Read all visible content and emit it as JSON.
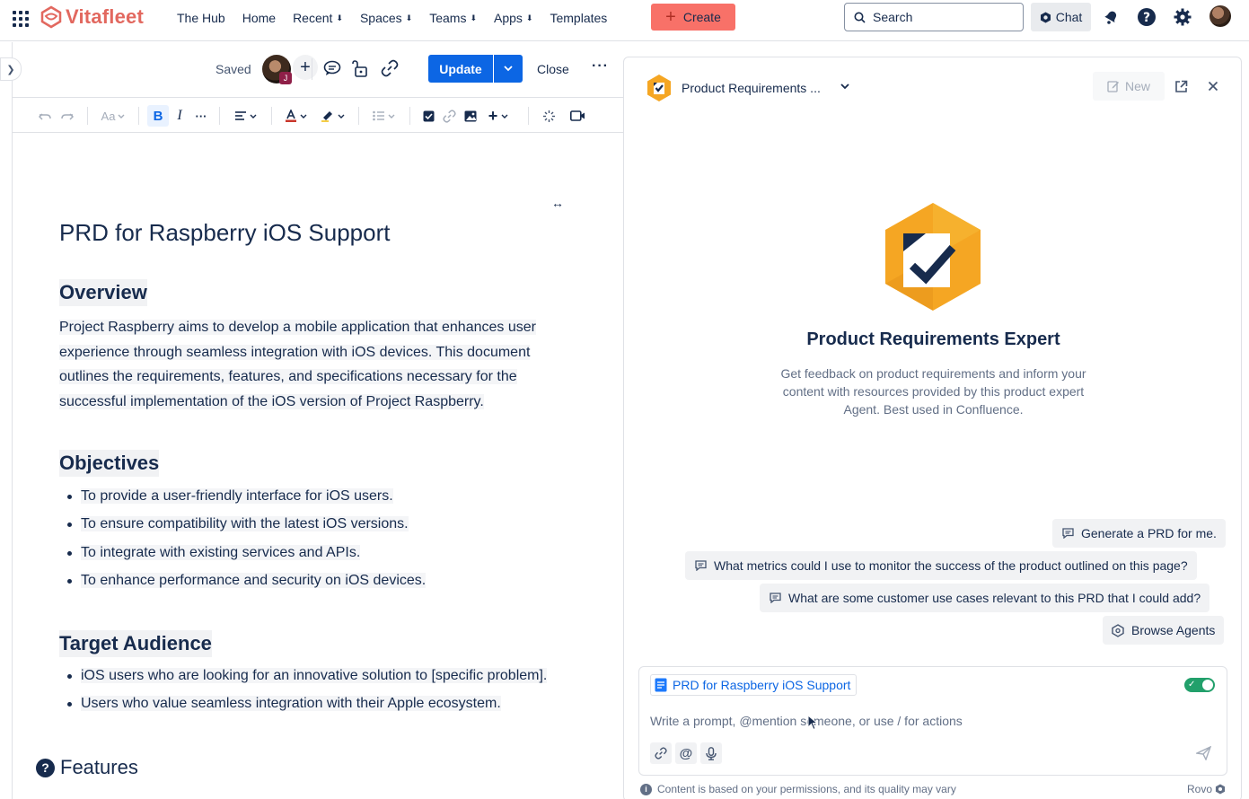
{
  "topnav": {
    "brand": "Vitafleet",
    "items": [
      {
        "label": "The Hub",
        "dropdown": false
      },
      {
        "label": "Home",
        "dropdown": false
      },
      {
        "label": "Recent",
        "dropdown": true
      },
      {
        "label": "Spaces",
        "dropdown": true
      },
      {
        "label": "Teams",
        "dropdown": true
      },
      {
        "label": "Apps",
        "dropdown": true
      },
      {
        "label": "Templates",
        "dropdown": false
      }
    ],
    "create_label": "Create",
    "search_placeholder": "Search",
    "chat_label": "Chat"
  },
  "editor": {
    "saved_label": "Saved",
    "avatar_badge": "J",
    "update_label": "Update",
    "close_label": "Close",
    "more_label": "···",
    "toolbar_text_style": "Aa"
  },
  "document": {
    "title": "PRD for Raspberry iOS Support",
    "overview_heading": "Overview",
    "overview_lines": [
      "Project Raspberry aims to develop a mobile application that enhances user",
      "experience through seamless integration with iOS devices. This document",
      "outlines the requirements, features, and specifications necessary for the",
      "successful implementation of the iOS version of Project Raspberry."
    ],
    "objectives_heading": "Objectives",
    "objectives": [
      "To provide a user-friendly interface for iOS users.",
      "To ensure compatibility with the latest iOS versions.",
      "To integrate with existing services and APIs.",
      "To enhance performance and security on iOS devices."
    ],
    "audience_heading": "Target Audience",
    "audience": [
      "iOS users who are looking for an innovative solution to [specific problem].",
      "Users who value seamless integration with their Apple ecosystem."
    ],
    "features_heading": "Features"
  },
  "panel": {
    "agent_title": "Product Requirements ...",
    "new_label": "New",
    "expert_name": "Product Requirements Expert",
    "expert_desc": "Get feedback on product requirements and inform your content with resources provided by this product expert Agent. Best used in Confluence.",
    "suggestions": [
      "Generate a PRD for me.",
      "What metrics could I use to monitor the success of the product outlined on this page?",
      "What are some customer use cases relevant to this PRD that I could add?"
    ],
    "browse_label": "Browse Agents",
    "context_chip": "PRD for Raspberry iOS Support",
    "context_enabled": true,
    "prompt_placeholder": "Write a prompt, @mention someone, or use / for actions",
    "disclaimer": "Content is based on your permissions, and its quality may vary",
    "rovo_label": "Rovo"
  },
  "colors": {
    "brand": "#e2685f",
    "create": "#f87168",
    "primary": "#0c66e4",
    "agent_orange": "#f5a623",
    "toggle_on": "#22a06b"
  }
}
